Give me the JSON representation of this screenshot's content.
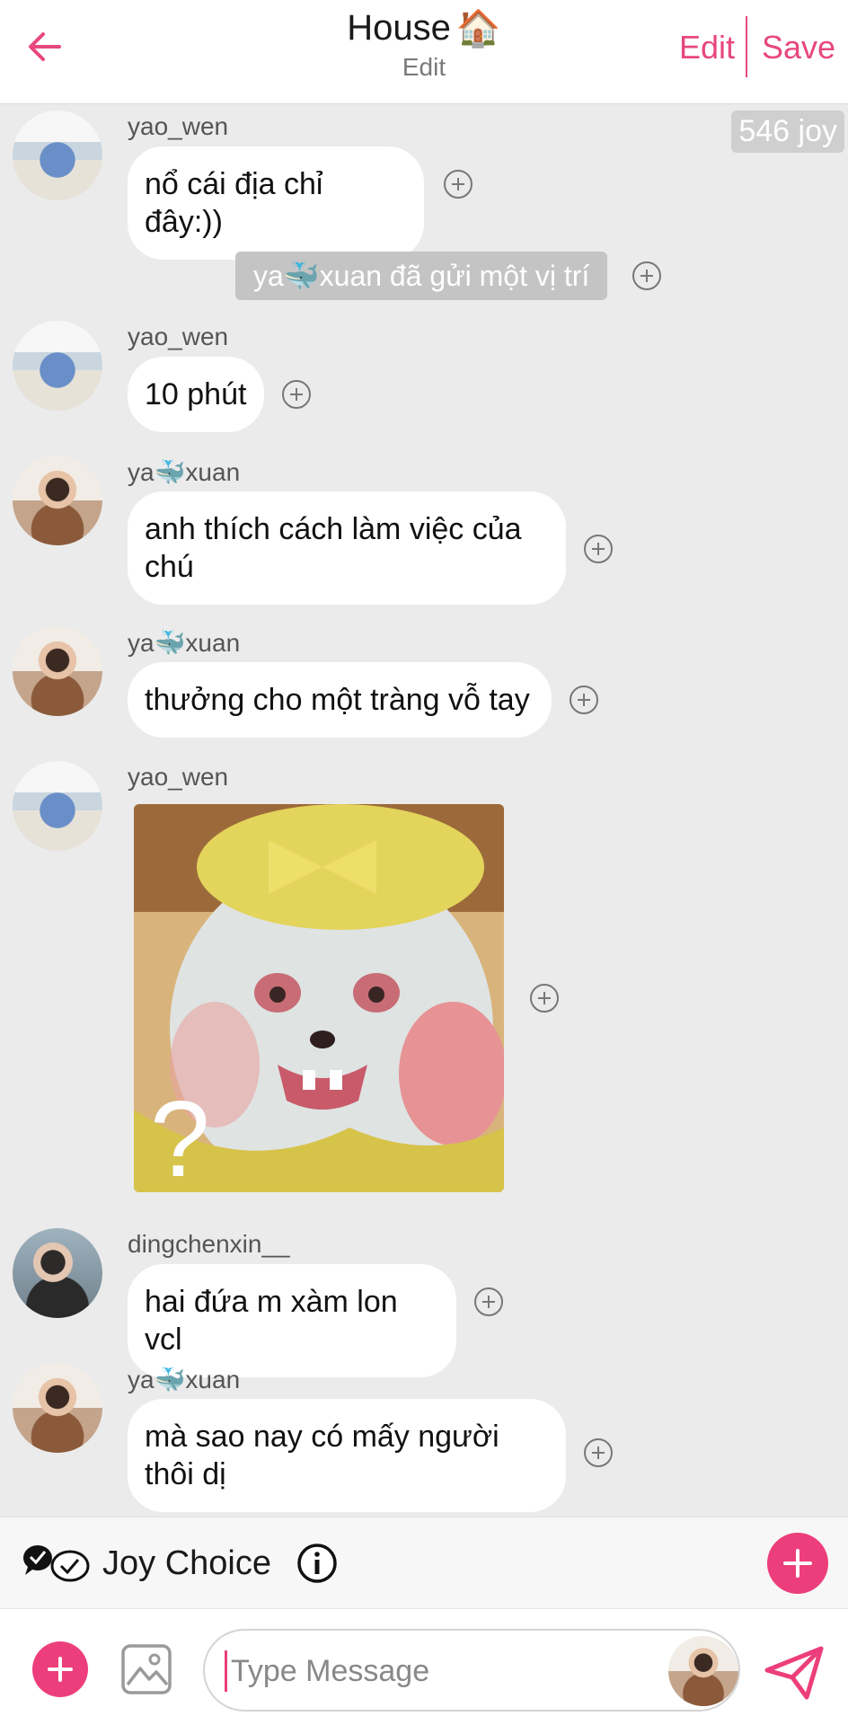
{
  "header": {
    "title": "House",
    "title_emoji": "🏠",
    "subtitle": "Edit",
    "edit_label": "Edit",
    "save_label": "Save",
    "accent_color": "#e8477f"
  },
  "chat": {
    "joy_count": "546 joy",
    "system_message": "ya🐳xuan đã gửi một vị trí",
    "messages": [
      {
        "user": "yao_wen",
        "text": "nổ cái địa chỉ đây:))"
      },
      {
        "user": "yao_wen",
        "text": "10 phút"
      },
      {
        "user": "ya🐳xuan",
        "text": "anh thích cách làm việc của chú"
      },
      {
        "user": "ya🐳xuan",
        "text": "thưởng cho một tràng vỗ tay"
      },
      {
        "user": "yao_wen",
        "sticker": "question-mark-sticker",
        "sticker_text": "?"
      },
      {
        "user": "dingchenxin__",
        "text": "hai đứa m xàm lon vcl"
      },
      {
        "user": "ya🐳xuan",
        "text": "mà sao nay có mấy người thôi dị"
      }
    ]
  },
  "joy_choice": {
    "label": "Joy Choice",
    "add_color": "#ec3e7b"
  },
  "composer": {
    "placeholder": "Type Message",
    "value": ""
  }
}
